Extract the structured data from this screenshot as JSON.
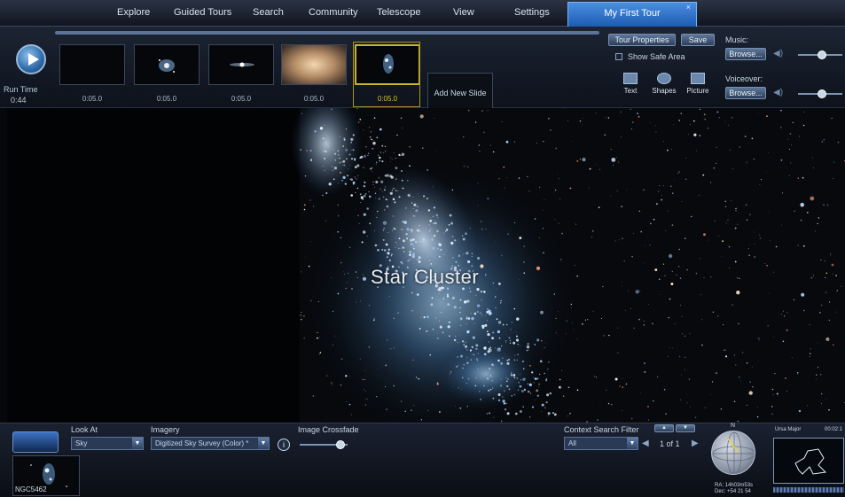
{
  "menu": {
    "items": [
      "Explore",
      "Guided Tours",
      "Search",
      "Community",
      "Telescope",
      "View",
      "Settings"
    ],
    "active_tab": "My First Tour",
    "close_glyph": "×"
  },
  "tour": {
    "run_time_label": "Run Time",
    "run_time_value": "0:44",
    "slides": [
      {
        "duration": "0:05.0",
        "thumb": "black"
      },
      {
        "duration": "0:05.0",
        "thumb": "spiral-galaxy"
      },
      {
        "duration": "0:05.0",
        "thumb": "edge-galaxy"
      },
      {
        "duration": "0:05.0",
        "thumb": "nebula"
      },
      {
        "duration": "0:05.0",
        "thumb": "star-cluster",
        "selected": true
      }
    ],
    "add_slide_label": "Add New Slide",
    "tour_properties_label": "Tour Properties",
    "save_label": "Save",
    "show_safe_area_label": "Show Safe Area",
    "text_label": "Text",
    "shapes_label": "Shapes",
    "picture_label": "Picture",
    "music_label": "Music:",
    "voiceover_label": "Voiceover:",
    "browse_label": "Browse..."
  },
  "sky": {
    "caption": "Star Cluster"
  },
  "bottom": {
    "look_at_label": "Look At",
    "look_at_value": "Sky",
    "imagery_label": "Imagery",
    "imagery_value": "Digitized Sky Survey (Color) *",
    "crossfade_label": "Image Crossfade",
    "crossfade_level": 0.85,
    "context_filter_label": "Context Search Filter",
    "context_filter_value": "All",
    "page_indicator": "1 of 1",
    "result_label": "NGC5462",
    "compass_north": "N",
    "ra": "RA: 14h03m53s",
    "dec": "Dec: +54 21 54",
    "constellation": "Ursa Major",
    "time": "00:02:1"
  },
  "colors": {
    "accent": "#2d6ec8",
    "selected_slide": "#c8b230"
  }
}
